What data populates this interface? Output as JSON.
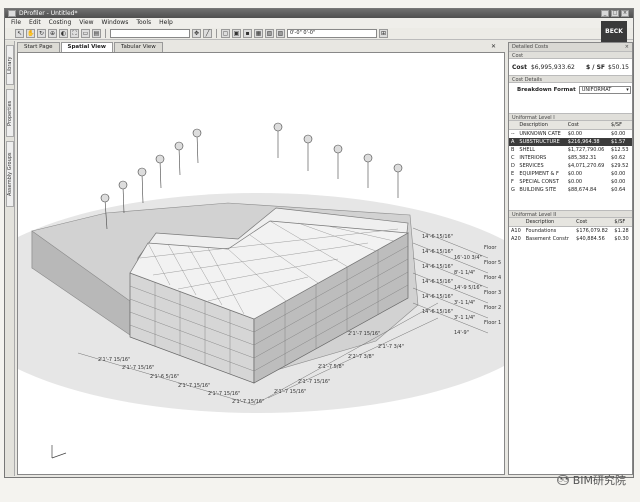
{
  "window": {
    "title": "DProfiler - Untitled*"
  },
  "menu": [
    {
      "label": "File"
    },
    {
      "label": "Edit"
    },
    {
      "label": "Costing"
    },
    {
      "label": "View"
    },
    {
      "label": "Windows"
    },
    {
      "label": "Tools"
    },
    {
      "label": "Help"
    }
  ],
  "logo": {
    "text": "BECK"
  },
  "toolbar": {
    "select1": "",
    "select2": "0'-0\"    0'-0\""
  },
  "left_tabs": [
    {
      "label": "Library"
    },
    {
      "label": "Properties"
    },
    {
      "label": "Assembly Groups"
    }
  ],
  "doc_tabs": [
    {
      "label": "Start Page",
      "active": false
    },
    {
      "label": "Spatial View",
      "active": true
    },
    {
      "label": "Tabular View",
      "active": false
    }
  ],
  "close_glyph": "✕",
  "scene": {
    "floor_labels": [
      "Floor",
      "Floor 5",
      "Floor 4",
      "Floor 3",
      "Floor 2",
      "Floor 1"
    ],
    "height_dims": [
      "14'-6 15/16\"",
      "14'-6 15/16\"",
      "14'-6 15/16\"",
      "14'-6 15/16\"",
      "14'-6 15/16\"",
      "14'-6 15/16\""
    ],
    "right_dims": [
      "16'-10 3/4\"",
      "8'-1 1/4\"",
      "14'-9 5/16\"",
      "3'-1 1/4\"",
      "3'-1 1/4\"",
      "14'-9\""
    ],
    "front_dims": [
      "2'1'-6 5/16\"",
      "2'1'-7 15/16\"",
      "2'1'-7 15/16\"",
      "2'1'-7 15/16\"",
      "2'1'-7 15/16\"",
      "2'1'-7 15/16\""
    ],
    "back_dims": [
      "2'1'-7 3/4\"",
      "2'2'-7 3/8\"",
      "2'1'-7 5/8\""
    ],
    "side_dims": [
      "2'1'-7 15/16\"",
      "2'1'-7 15/16\"",
      "2'1'-7 15/16\""
    ]
  },
  "panel": {
    "title": "Detailed Costs",
    "cost_section": "Cost",
    "cost_label": "Cost",
    "cost_value": "$6,995,933.62",
    "sf_label": "$ / SF",
    "sf_value": "$50.15",
    "cost_details": "Cost Details",
    "breakdown_label": "Breakdown Format",
    "breakdown_value": "UNIFORMAT",
    "level1": {
      "title": "Uniformat Level I",
      "headers": [
        "",
        "Description",
        "Cost",
        "$/SF"
      ],
      "rows": [
        {
          "code": "--",
          "desc": "UNKNOWN CATE",
          "cost": "$0.00",
          "sf": "$0.00"
        },
        {
          "code": "A",
          "desc": "SUBSTRUCTURE",
          "cost": "$216,964.38",
          "sf": "$1.57",
          "selected": true
        },
        {
          "code": "B",
          "desc": "SHELL",
          "cost": "$1,727,790.06",
          "sf": "$12.53"
        },
        {
          "code": "C",
          "desc": "INTERIORS",
          "cost": "$85,382.31",
          "sf": "$0.62"
        },
        {
          "code": "D",
          "desc": "SERVICES",
          "cost": "$4,071,270.69",
          "sf": "$29.52"
        },
        {
          "code": "E",
          "desc": "EQUIPMENT & F",
          "cost": "$0.00",
          "sf": "$0.00"
        },
        {
          "code": "F",
          "desc": "SPECIAL CONST",
          "cost": "$0.00",
          "sf": "$0.00"
        },
        {
          "code": "G",
          "desc": "BUILDING SITE",
          "cost": "$88,674.84",
          "sf": "$0.64"
        }
      ]
    },
    "level2": {
      "title": "Uniformat Level II",
      "headers": [
        "",
        "Description",
        "Cost",
        "$/SF"
      ],
      "rows": [
        {
          "code": "A10",
          "desc": "Foundations",
          "cost": "$176,079.82",
          "sf": "$1.28"
        },
        {
          "code": "A20",
          "desc": "Basement Constr",
          "cost": "$40,884.56",
          "sf": "$0.30"
        }
      ]
    }
  },
  "watermark": {
    "text": "BIM研究院"
  }
}
